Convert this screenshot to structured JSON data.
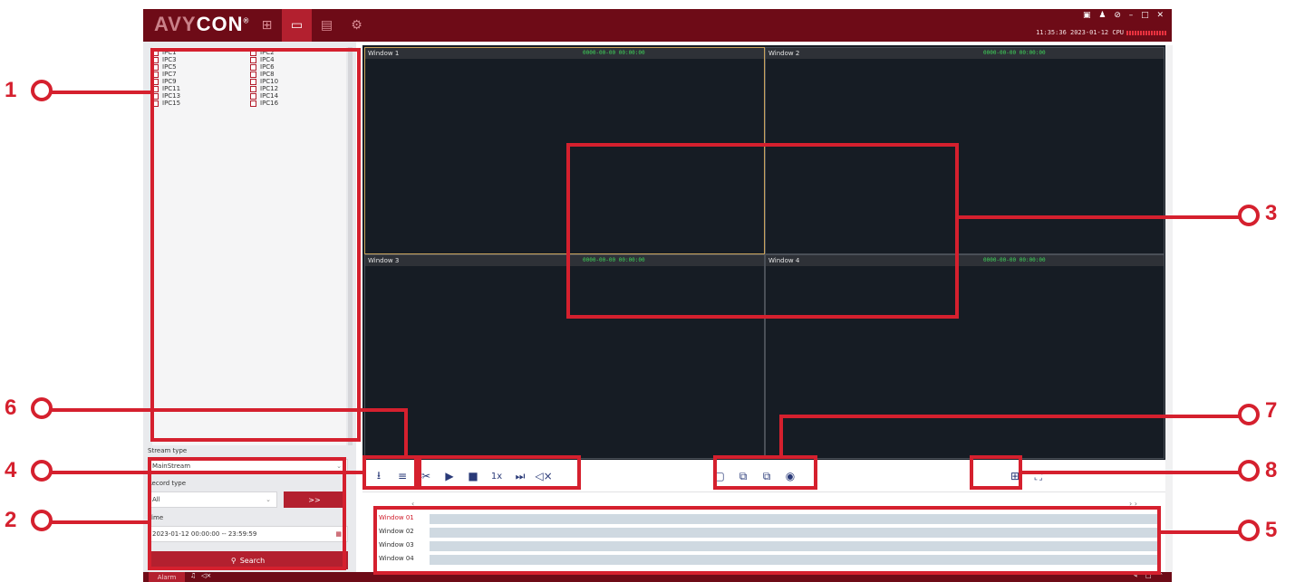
{
  "app": {
    "logo_prefix": "AVY",
    "logo_suffix": "CON",
    "registered": "®",
    "nav": [
      {
        "icon": "layout-icon",
        "glyph": "⊞"
      },
      {
        "icon": "playback-icon",
        "glyph": "▭"
      },
      {
        "icon": "monitor-icon",
        "glyph": "▤"
      },
      {
        "icon": "settings-icon",
        "glyph": "⚙"
      }
    ],
    "window_controls": "▣ ♟ ⊘ – □ ✕",
    "clock": "11:35:36 2023-01-12 CPU"
  },
  "cameras": [
    "IPC1",
    "IPC2",
    "IPC3",
    "IPC4",
    "IPC5",
    "IPC6",
    "IPC7",
    "IPC8",
    "IPC9",
    "IPC10",
    "IPC11",
    "IPC12",
    "IPC13",
    "IPC14",
    "IPC15",
    "IPC16"
  ],
  "filters": {
    "stream_type_label": "Stream type",
    "stream_type_value": "MainStream",
    "record_type_label": "Record type",
    "record_type_value": "All",
    "time_label": "Time",
    "time_value": "2023-01-12 00:00:00 -- 23:59:59",
    "go_label": ">>",
    "search_label": "Search"
  },
  "video_windows": [
    {
      "name": "Window 1",
      "time": "0000-00-00 00:00:00",
      "selected": true
    },
    {
      "name": "Window 2",
      "time": "0000-00-00 00:00:00",
      "selected": false
    },
    {
      "name": "Window 3",
      "time": "0000-00-00 00:00:00",
      "selected": false
    },
    {
      "name": "Window 4",
      "time": "0000-00-00 00:00:00",
      "selected": false
    }
  ],
  "toolbar": {
    "speed": "1x",
    "left_icons": [
      "download-icon",
      "playlist-icon",
      "clip-icon",
      "play-icon",
      "stop-icon",
      "speed-icon",
      "next-frame-icon",
      "mute-icon"
    ],
    "mid_icons": [
      "sync-play-icon",
      "async-play-icon",
      "copy-window-icon",
      "snapshot-icon"
    ],
    "right_icons": [
      "split-layout-icon",
      "fullscreen-icon"
    ]
  },
  "timeline": {
    "rows": [
      {
        "label": "Window 01",
        "active": true
      },
      {
        "label": "Window 02",
        "active": false
      },
      {
        "label": "Window 03",
        "active": false
      },
      {
        "label": "Window 04",
        "active": false
      }
    ]
  },
  "statusbar": {
    "alarm_label": "Alarm"
  },
  "callouts": [
    "1",
    "2",
    "3",
    "4",
    "5",
    "6",
    "7",
    "8"
  ],
  "colors": {
    "brand": "#6e0b17",
    "accent": "#b3202f",
    "callout": "#d5202e",
    "timestamp": "#3fd85a"
  }
}
